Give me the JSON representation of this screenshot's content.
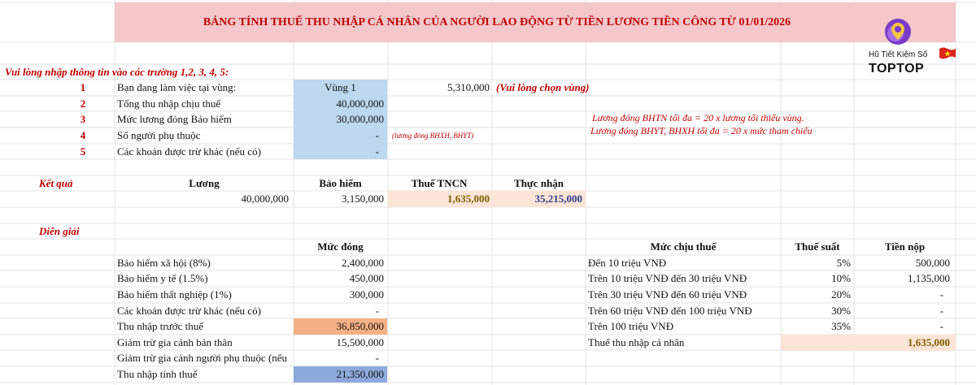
{
  "sheet": {
    "title": "BẢNG TÍNH THUẾ THU NHẬP CÁ NHÂN CỦA NGƯỜI LAO ĐỘNG TỪ TIỀN LƯƠNG TIỀN CÔNG TỪ 01/01/2026",
    "instruction": "Vui lòng nhập thông tin vào các trường 1,2, 3, 4, 5:",
    "inputs": [
      {
        "num": "1",
        "label": "Bạn đang làm việc tại vùng:",
        "value": "Vùng 1"
      },
      {
        "num": "2",
        "label": "Tổng thu nhập chịu thuế",
        "value": "40,000,000"
      },
      {
        "num": "3",
        "label": "Mức lương đóng Bảo hiểm",
        "value": "30,000,000"
      },
      {
        "num": "4",
        "label": "Số người phụ thuộc",
        "value": "-"
      },
      {
        "num": "5",
        "label": "Các khoản được trừ khác (nếu có)",
        "value": "-"
      }
    ],
    "region_wage": "5,310,000",
    "region_hint": "(Vui lòng chọn vùng)",
    "insurance_hint": "(lương đóng BHXH, BHYT)",
    "notes": [
      "Lương đóng BHTN tối đa = 20 x lương tối thiểu vùng.",
      "Lương đóng BHYT, BHXH tối đa = 20 x mức tham chiếu"
    ],
    "result": {
      "heading": "Kết quả",
      "headers": [
        "Lương",
        "Bảo hiểm",
        "Thuế TNCN",
        "Thực nhận"
      ],
      "values": [
        "40,000,000",
        "3,150,000",
        "1,635,000",
        "35,215,000"
      ]
    },
    "breakdown": {
      "heading": "Diễn giải",
      "header": "Mức đóng",
      "rows": [
        {
          "label": "Bảo hiểm xã hội (8%)",
          "value": "2,400,000"
        },
        {
          "label": "Bảo hiểm y tế (1.5%)",
          "value": "450,000"
        },
        {
          "label": "Bảo hiểm thất nghiệp (1%)",
          "value": "300,000"
        },
        {
          "label": "Các khoản được trừ khác (nếu có)",
          "value": "-"
        },
        {
          "label": "Thu nhập trước thuế",
          "value": "36,850,000"
        },
        {
          "label": "Giảm trừ gia cảnh bản thân",
          "value": "15,500,000"
        },
        {
          "label": "Giảm trừ gia cảnh người phụ thuộc (nếu",
          "value": "-"
        },
        {
          "label": "Thu nhập tính thuế",
          "value": "21,350,000"
        }
      ]
    },
    "tax_table": {
      "headers": [
        "Mức chịu thuế",
        "Thuế suất",
        "Tiền nộp"
      ],
      "rows": [
        {
          "bracket": "Đến 10 triệu VNĐ",
          "rate": "5%",
          "amount": "500,000"
        },
        {
          "bracket": "Trên 10 triệu VNĐ đến 30 triệu VNĐ",
          "rate": "10%",
          "amount": "1,135,000"
        },
        {
          "bracket": "Trên 30 triệu VNĐ đến 60 triệu VNĐ",
          "rate": "20%",
          "amount": "-"
        },
        {
          "bracket": "Trên 60 triệu VNĐ đến 100 triệu VNĐ",
          "rate": "30%",
          "amount": "-"
        },
        {
          "bracket": "Trên 100 triệu VNĐ",
          "rate": "35%",
          "amount": "-"
        }
      ],
      "total_label": "Thuế thu nhập cá nhân",
      "total_value": "1,635,000"
    }
  },
  "logo": {
    "tagline": "Hũ Tiết Kiệm Số",
    "brand": "TOPTOP",
    "icon": "location-pin-icon",
    "flag": "vietnam-flag-icon"
  },
  "colors": {
    "title_band": "#f4c7cb",
    "title_text": "#c00000",
    "input_fill": "#bdd7ee",
    "result_fill": "#fce4d6",
    "pretax_fill": "#f4b084",
    "taxable_fill": "#8ea9db",
    "tax_value": "#7f6000",
    "net_value": "#2f3f8f",
    "gridline": "#e3e3e3"
  }
}
